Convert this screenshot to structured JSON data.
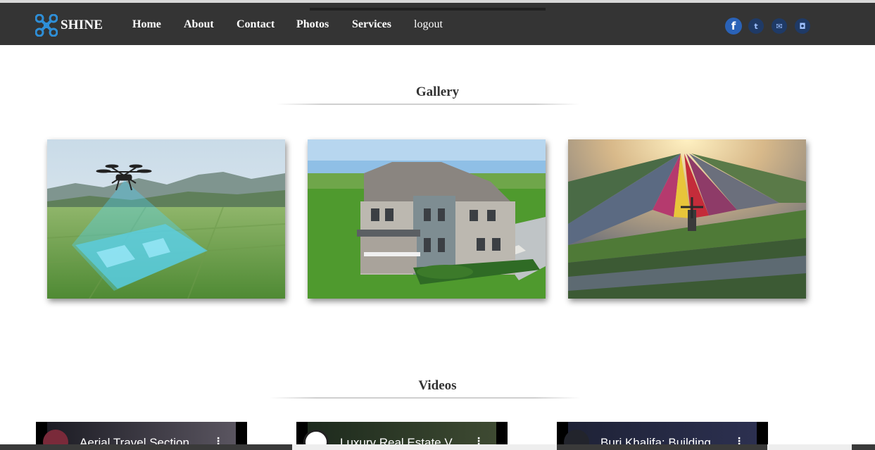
{
  "brand": {
    "name": "SHINE",
    "logo_icon": "drone-logo-icon",
    "accent": "#2e8fd8"
  },
  "nav": {
    "items": [
      {
        "label": "Home"
      },
      {
        "label": "About"
      },
      {
        "label": "Contact"
      },
      {
        "label": "Photos"
      },
      {
        "label": "Services"
      },
      {
        "label": "logout"
      }
    ],
    "background": "#343434"
  },
  "social": [
    {
      "icon": "facebook-icon",
      "glyph": "f"
    },
    {
      "icon": "twitter-icon",
      "glyph": "t"
    },
    {
      "icon": "email-icon",
      "glyph": "✉"
    },
    {
      "icon": "instagram-icon",
      "glyph": "◘"
    }
  ],
  "gallery": {
    "title": "Gallery",
    "photos": [
      {
        "subject": "drone-survey-photo"
      },
      {
        "subject": "house-aerial-photo"
      },
      {
        "subject": "tulip-fields-photo"
      }
    ]
  },
  "videos": {
    "title": "Videos",
    "items": [
      {
        "title": "Aerial Travel Section",
        "menu": "⋮"
      },
      {
        "title": "Luxury Real Estate V",
        "menu": "⋮"
      },
      {
        "title": "Burj Khalifa: Building",
        "menu": "⋮"
      }
    ]
  }
}
